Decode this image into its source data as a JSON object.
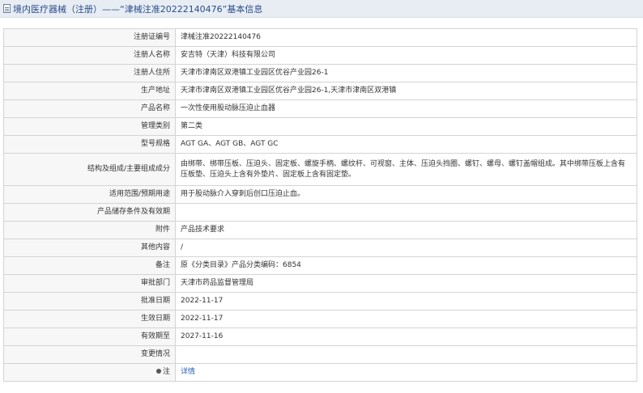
{
  "header": {
    "title": "境内医疗器械（注册）——“津械注准20222140476”基本信息"
  },
  "rows": [
    {
      "label": "注册证编号",
      "value": "津械注准20222140476"
    },
    {
      "label": "注册人名称",
      "value": "安吉特（天津）科技有限公司"
    },
    {
      "label": "注册人住所",
      "value": "天津市津南区双港镇工业园区优谷产业园26-1"
    },
    {
      "label": "生产地址",
      "value": "天津市津南区双港镇工业园区优谷产业园26-1,天津市津南区双港镇"
    },
    {
      "label": "产品名称",
      "value": "一次性使用股动脉压迫止血器"
    },
    {
      "label": "管理类别",
      "value": "第二类"
    },
    {
      "label": "型号规格",
      "value": "AGT GA、AGT GB、AGT GC"
    },
    {
      "label": "结构及组成/主要组成成分",
      "value": "由绑带、绑带压板、压迫头、固定板、螺旋手柄、螺纹杆、可视窗、主体、压迫头挡圈、螺钉、螺母、螺钉盖帽组成。其中绑带压板上含有压板垫、压迫头上含有外垫片、固定板上含有固定垫。"
    },
    {
      "label": "适用范围/预期用途",
      "value": "用于股动脉介入穿刺后创口压迫止血。"
    },
    {
      "label": "产品储存条件及有效期",
      "value": ""
    },
    {
      "label": "附件",
      "value": "产品技术要求"
    },
    {
      "label": "其他内容",
      "value": "/"
    },
    {
      "label": "备注",
      "value": "原《分类目录》产品分类编码：6854"
    },
    {
      "label": "审批部门",
      "value": "天津市药品监督管理局"
    },
    {
      "label": "批准日期",
      "value": "2022-11-17"
    },
    {
      "label": "生效日期",
      "value": "2022-11-17"
    },
    {
      "label": "有效期至",
      "value": "2027-11-16"
    },
    {
      "label": "变更情况",
      "value": ""
    }
  ],
  "note_row": {
    "label": "注",
    "link_text": "详情"
  }
}
